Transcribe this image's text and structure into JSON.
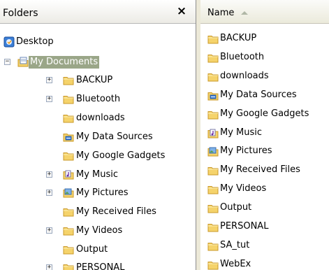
{
  "folders_pane": {
    "title": "Folders",
    "close_glyph": "×",
    "tree": [
      {
        "label": "Desktop",
        "icon": "desktop-icon",
        "expander": null,
        "selected": false
      },
      {
        "label": "My Documents",
        "icon": "my-documents-icon",
        "expander": "−",
        "selected": true
      },
      {
        "label": "BACKUP",
        "icon": "folder-icon",
        "expander": "+",
        "selected": false
      },
      {
        "label": "Bluetooth",
        "icon": "folder-icon",
        "expander": "+",
        "selected": false
      },
      {
        "label": "downloads",
        "icon": "folder-icon",
        "expander": null,
        "selected": false
      },
      {
        "label": "My Data Sources",
        "icon": "data-sources-icon",
        "expander": null,
        "selected": false
      },
      {
        "label": "My Google Gadgets",
        "icon": "folder-icon",
        "expander": null,
        "selected": false
      },
      {
        "label": "My Music",
        "icon": "music-folder-icon",
        "expander": "+",
        "selected": false
      },
      {
        "label": "My Pictures",
        "icon": "pictures-folder-icon",
        "expander": "+",
        "selected": false
      },
      {
        "label": "My Received Files",
        "icon": "folder-icon",
        "expander": null,
        "selected": false
      },
      {
        "label": "My Videos",
        "icon": "folder-icon",
        "expander": "+",
        "selected": false
      },
      {
        "label": "Output",
        "icon": "folder-icon",
        "expander": null,
        "selected": false
      },
      {
        "label": "PERSONAL",
        "icon": "folder-icon",
        "expander": "+",
        "selected": false
      }
    ]
  },
  "list_pane": {
    "column_header": "Name",
    "sort": "ascending",
    "items": [
      {
        "label": "BACKUP",
        "icon": "folder-icon"
      },
      {
        "label": "Bluetooth",
        "icon": "folder-icon"
      },
      {
        "label": "downloads",
        "icon": "folder-icon"
      },
      {
        "label": "My Data Sources",
        "icon": "data-sources-icon"
      },
      {
        "label": "My Google Gadgets",
        "icon": "folder-icon"
      },
      {
        "label": "My Music",
        "icon": "music-folder-icon"
      },
      {
        "label": "My Pictures",
        "icon": "pictures-folder-icon"
      },
      {
        "label": "My Received Files",
        "icon": "folder-icon"
      },
      {
        "label": "My Videos",
        "icon": "folder-icon"
      },
      {
        "label": "Output",
        "icon": "folder-icon"
      },
      {
        "label": "PERSONAL",
        "icon": "folder-icon"
      },
      {
        "label": "SA_tut",
        "icon": "folder-icon"
      },
      {
        "label": "WebEx",
        "icon": "folder-icon"
      }
    ]
  },
  "colors": {
    "selection": "#9aa688",
    "folder": "#f5d36b",
    "folder_edge": "#c9982a"
  }
}
